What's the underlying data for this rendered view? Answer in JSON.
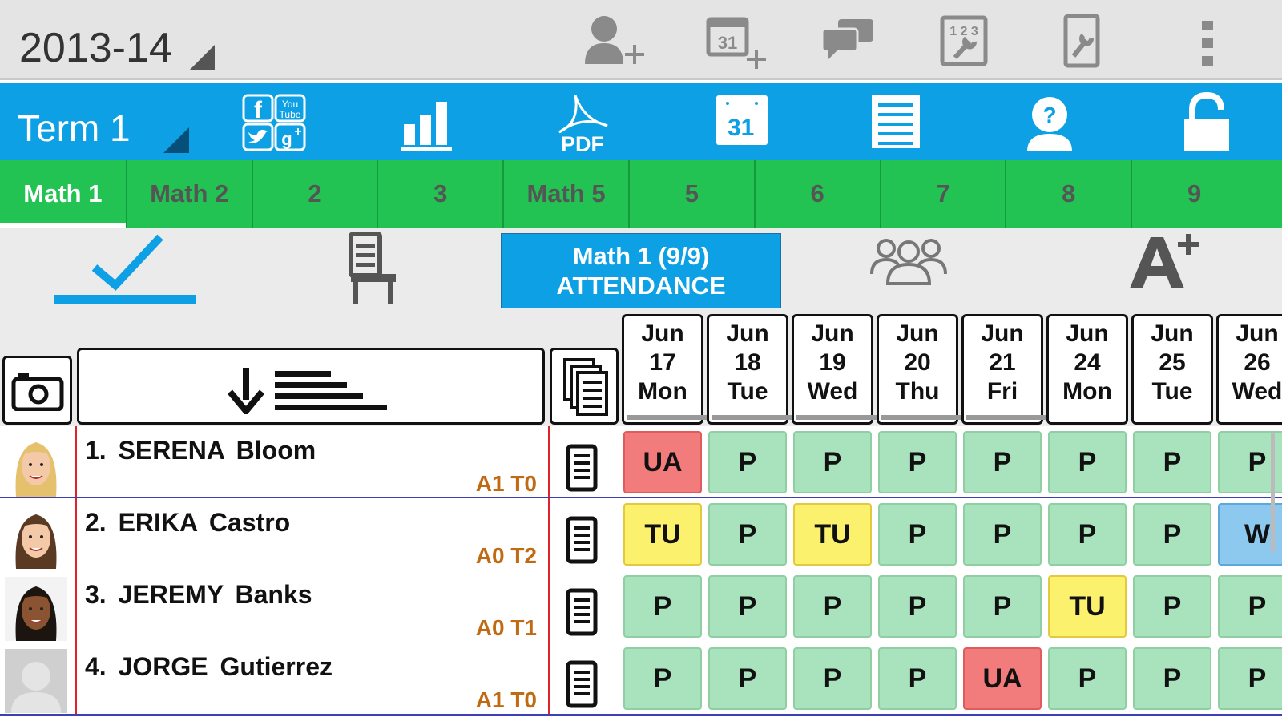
{
  "top_bar": {
    "year": "2013-14",
    "icons": [
      "add-student-icon",
      "add-calendar-event-icon",
      "messages-icon",
      "schedule-settings-icon",
      "settings-icon",
      "overflow-menu-icon"
    ]
  },
  "blue_bar": {
    "term": "Term 1",
    "icons": [
      "social-media-icon",
      "statistics-icon",
      "pdf-icon",
      "calendar-icon",
      "list-icon",
      "help-icon",
      "lock-icon"
    ],
    "pdf_label": "PDF",
    "calendar_day": "31",
    "social_youtube_label": "You Tube"
  },
  "tabs": [
    "Math 1",
    "Math 2",
    "2",
    "3",
    "Math 5",
    "5",
    "6",
    "7",
    "8",
    "9"
  ],
  "active_tab": 0,
  "mode": {
    "class_line1": "Math 1  (9/9)",
    "class_line2": "ATTENDANCE",
    "icons": [
      "attendance-check-icon",
      "seating-chair-icon",
      "groups-icon",
      "grades-icon"
    ]
  },
  "dates": [
    {
      "month": "Jun",
      "day": "17",
      "weekday": "Mon"
    },
    {
      "month": "Jun",
      "day": "18",
      "weekday": "Tue"
    },
    {
      "month": "Jun",
      "day": "19",
      "weekday": "Wed"
    },
    {
      "month": "Jun",
      "day": "20",
      "weekday": "Thu"
    },
    {
      "month": "Jun",
      "day": "21",
      "weekday": "Fri"
    },
    {
      "month": "Jun",
      "day": "24",
      "weekday": "Mon"
    },
    {
      "month": "Jun",
      "day": "25",
      "weekday": "Tue"
    },
    {
      "month": "Jun",
      "day": "26",
      "weekday": "Wed"
    }
  ],
  "students": [
    {
      "name": "1. SERENA  Bloom",
      "stat": "A1 T0",
      "avatar": "photo-blonde",
      "marks": [
        "UA",
        "P",
        "P",
        "P",
        "P",
        "P",
        "P",
        "P"
      ]
    },
    {
      "name": "2. ERIKA  Castro",
      "stat": "A0 T2",
      "avatar": "photo-brunette",
      "marks": [
        "TU",
        "P",
        "TU",
        "P",
        "P",
        "P",
        "P",
        "W"
      ]
    },
    {
      "name": "3. JEREMY  Banks",
      "stat": "A0 T1",
      "avatar": "photo-male",
      "marks": [
        "P",
        "P",
        "P",
        "P",
        "P",
        "TU",
        "P",
        "P"
      ]
    },
    {
      "name": "4. JORGE  Gutierrez",
      "stat": "A1 T0",
      "avatar": "placeholder",
      "marks": [
        "P",
        "P",
        "P",
        "P",
        "UA",
        "P",
        "P",
        "P"
      ]
    }
  ],
  "colors": {
    "blue": "#0ea0e4",
    "green": "#22c352",
    "present": "#a9e3bd",
    "unauthorized": "#f27b7b",
    "tardy": "#fbf16c",
    "w": "#8dc8ee"
  }
}
